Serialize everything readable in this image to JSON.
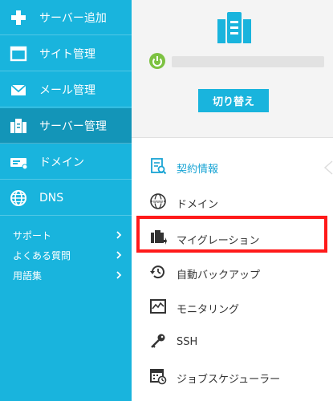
{
  "sidebar": {
    "items": [
      {
        "label": "サーバー追加",
        "icon": "plus-icon"
      },
      {
        "label": "サイト管理",
        "icon": "window-icon"
      },
      {
        "label": "メール管理",
        "icon": "mail-icon"
      },
      {
        "label": "サーバー管理",
        "icon": "server-manage-icon",
        "active": true
      },
      {
        "label": "ドメイン",
        "icon": "domain-card-icon"
      },
      {
        "label": "DNS",
        "icon": "globe-icon"
      }
    ],
    "links": [
      {
        "label": "サポート"
      },
      {
        "label": "よくある質問"
      },
      {
        "label": "用語集"
      }
    ]
  },
  "server_panel": {
    "switch_label": "切り替え"
  },
  "menu": {
    "items": [
      {
        "label": "契約情報",
        "icon": "contract-info-icon"
      },
      {
        "label": "ドメイン",
        "icon": "www-globe-icon"
      },
      {
        "label": "マイグレーション",
        "icon": "migration-icon"
      },
      {
        "label": "自動バックアップ",
        "icon": "backup-clock-icon"
      },
      {
        "label": "モニタリング",
        "icon": "monitoring-icon"
      },
      {
        "label": "SSH",
        "icon": "key-icon"
      },
      {
        "label": "ジョブスケジューラー",
        "icon": "scheduler-icon"
      }
    ]
  },
  "colors": {
    "sidebar": "#19b4dd",
    "sidebar_active": "#1395b8",
    "accent": "#19b4dd",
    "highlight": "#ff1a1a",
    "power": "#7dc242"
  }
}
